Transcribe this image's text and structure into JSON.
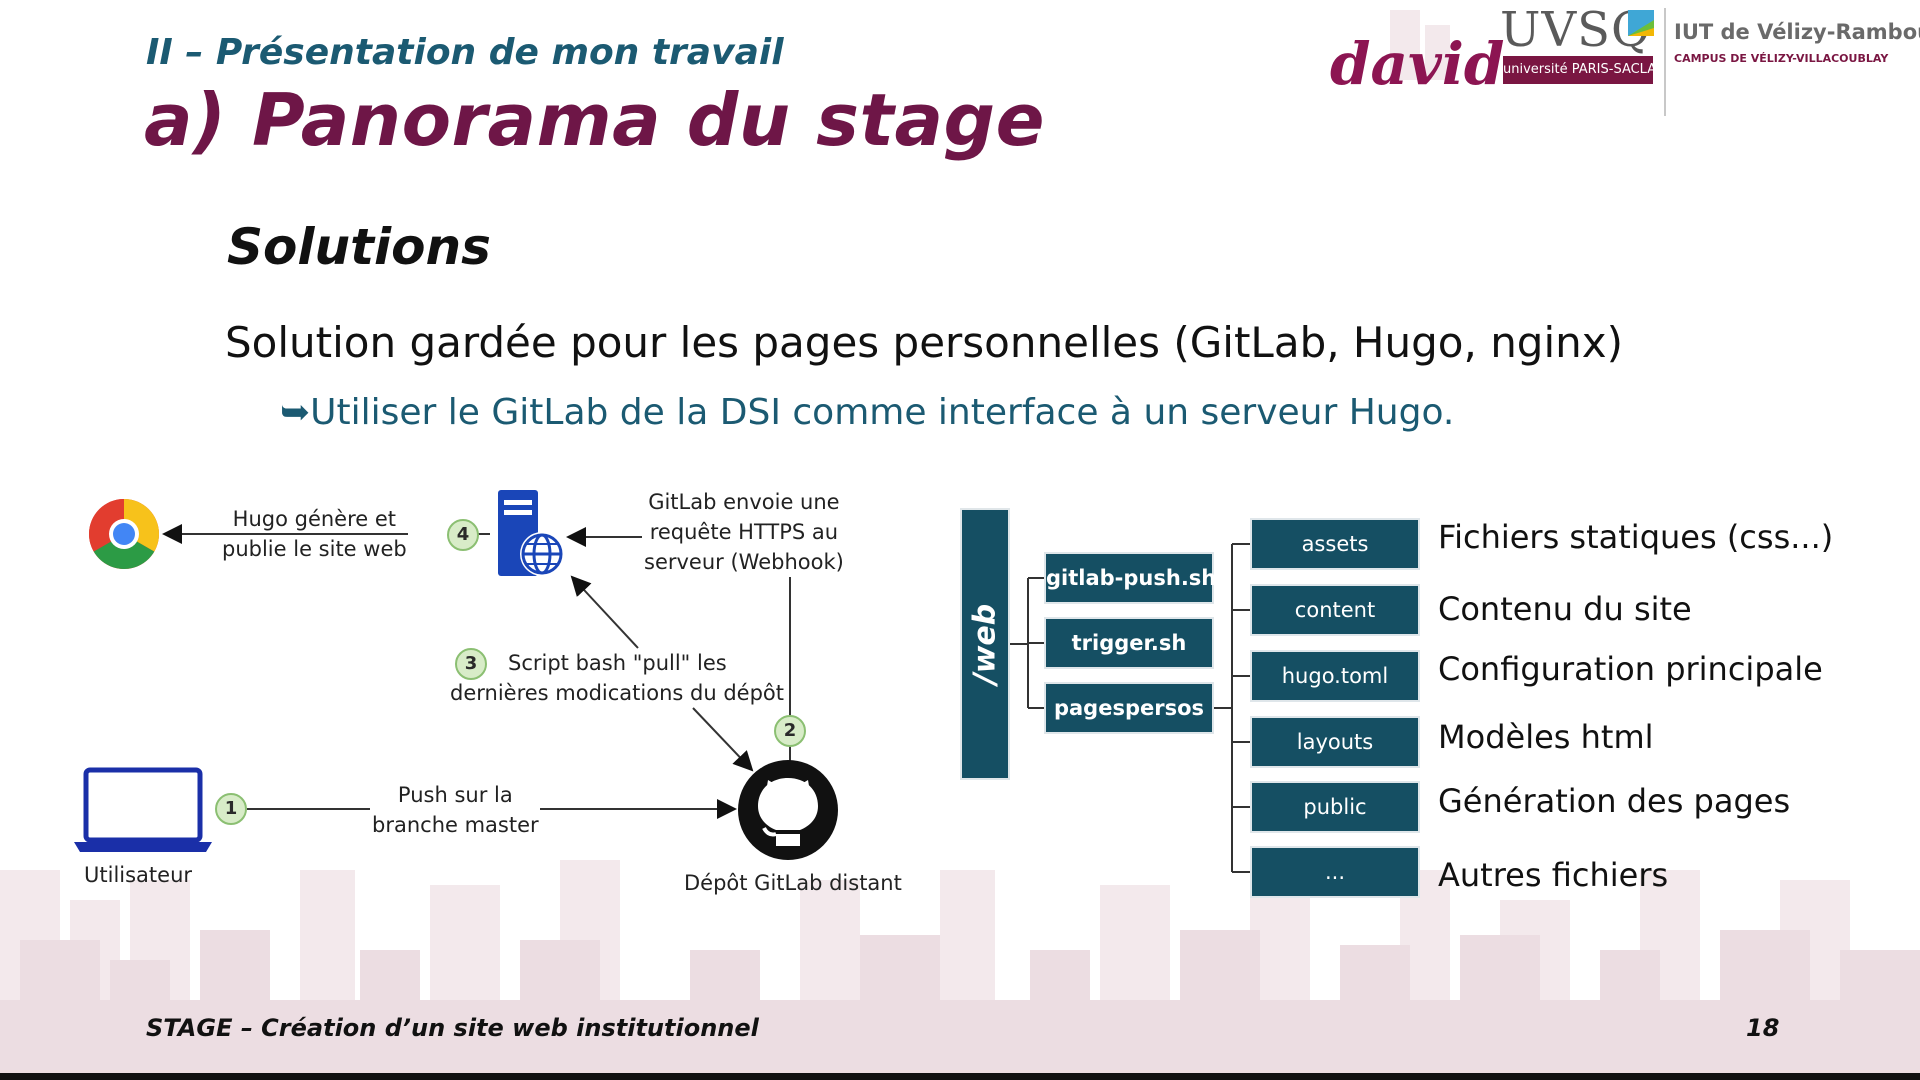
{
  "header": {
    "subtitle": "II – Présentation de mon travail",
    "title": "a) Panorama du stage"
  },
  "logos": {
    "david": "david",
    "uvsq": "UVSQ",
    "paris_saclay": "université PARIS-SACLAY",
    "iut_name": "IUT de Vélizy-Rambouillet",
    "iut_campus": "CAMPUS DE VÉLIZY-VILLACOUBLAY"
  },
  "content": {
    "section_heading": "Solutions",
    "lead": "Solution gardée pour les pages personnelles (GitLab, Hugo, nginx)",
    "point": "➥Utiliser le GitLab de la DSI comme interface à un serveur Hugo."
  },
  "flow": {
    "step4_line1": "Hugo génère et",
    "step4_line2": "publie le site web",
    "webhook_line1": "GitLab envoie une",
    "webhook_line2": "requête HTTPS au",
    "webhook_line3": "serveur (Webhook)",
    "step3_line1": "Script bash \"pull\" les",
    "step3_line2": "dernières modications du dépôt",
    "push_line1": "Push sur la",
    "push_line2": "branche master",
    "user_label": "Utilisateur",
    "repo_label": "Dépôt GitLab distant",
    "step_numbers": [
      "1",
      "2",
      "3",
      "4"
    ]
  },
  "tree": {
    "root": "/web",
    "scripts": [
      "gitlab-push.sh",
      "trigger.sh",
      "pagespersos"
    ],
    "dirs": [
      {
        "name": "assets",
        "desc": "Fichiers statiques (css...)"
      },
      {
        "name": "content",
        "desc": "Contenu du site"
      },
      {
        "name": "hugo.toml",
        "desc": "Configuration principale"
      },
      {
        "name": "layouts",
        "desc": "Modèles html"
      },
      {
        "name": "public",
        "desc": "Génération des pages"
      },
      {
        "name": "...",
        "desc": "Autres fichiers"
      }
    ]
  },
  "footer": {
    "left": "STAGE – Création d’un site web institutionnel",
    "page": "18"
  },
  "colors": {
    "title": "#6e1647",
    "subtitle": "#1b5a72",
    "box": "#154f63",
    "skyline": "#ede0e4",
    "brand": "#8c1552"
  }
}
